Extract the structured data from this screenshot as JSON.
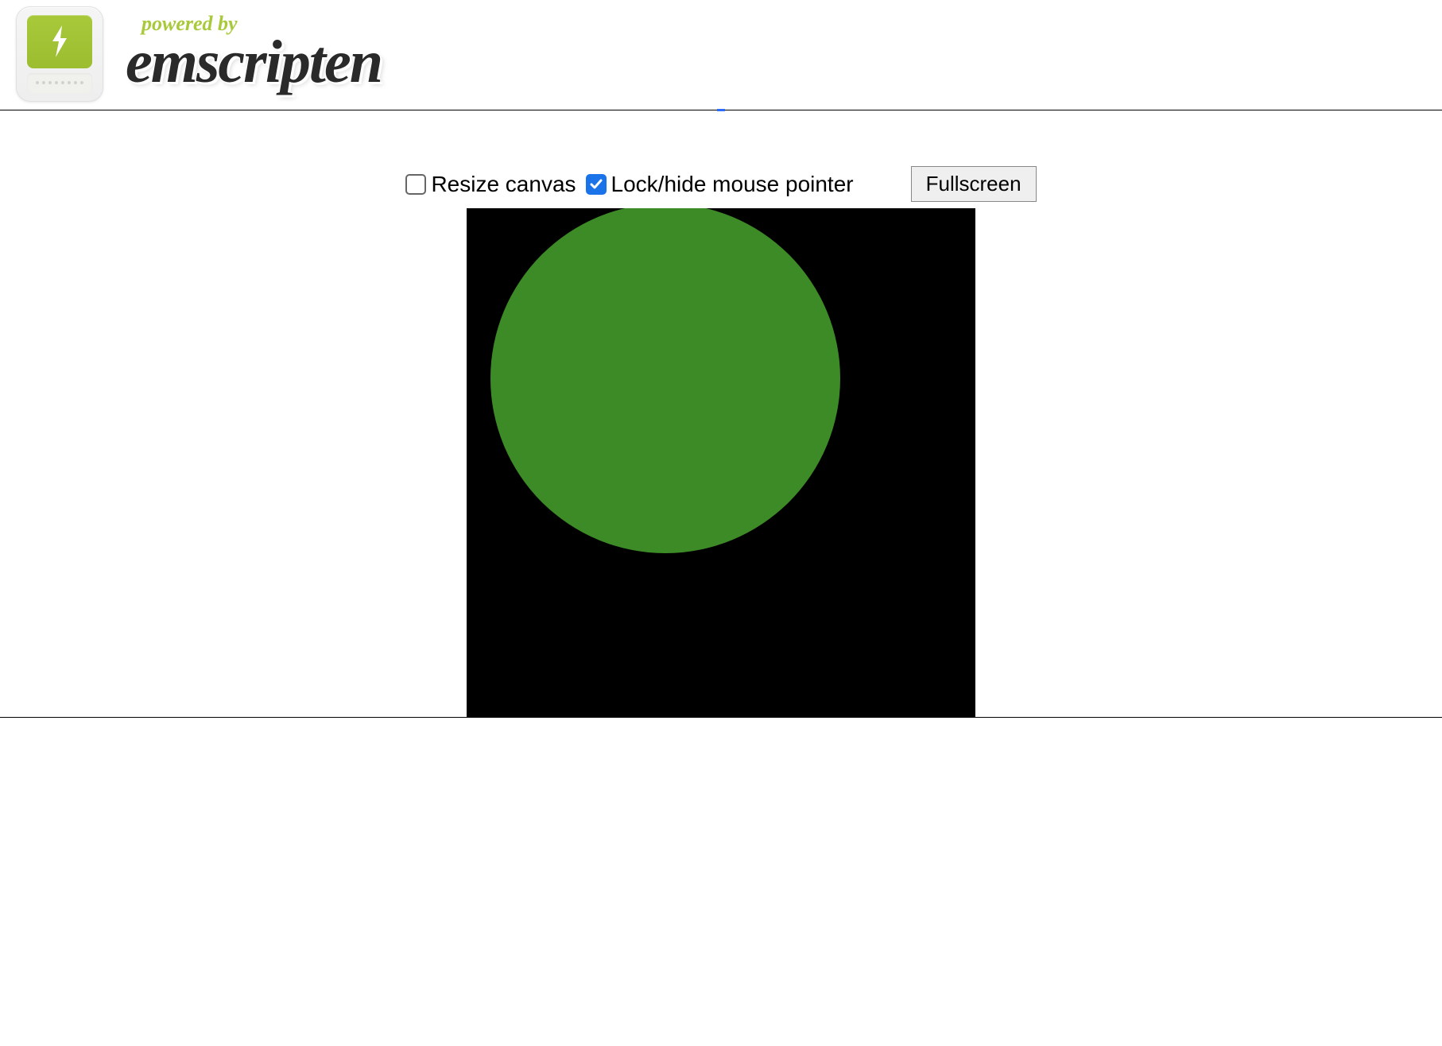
{
  "branding": {
    "powered_by": "powered by",
    "name": "emscripten"
  },
  "controls": {
    "resize_canvas": {
      "label": "Resize canvas",
      "checked": false
    },
    "lock_pointer": {
      "label": "Lock/hide mouse pointer",
      "checked": true
    },
    "fullscreen_label": "Fullscreen"
  },
  "canvas": {
    "background_color": "#000000",
    "circle_color": "#3d8b27"
  }
}
